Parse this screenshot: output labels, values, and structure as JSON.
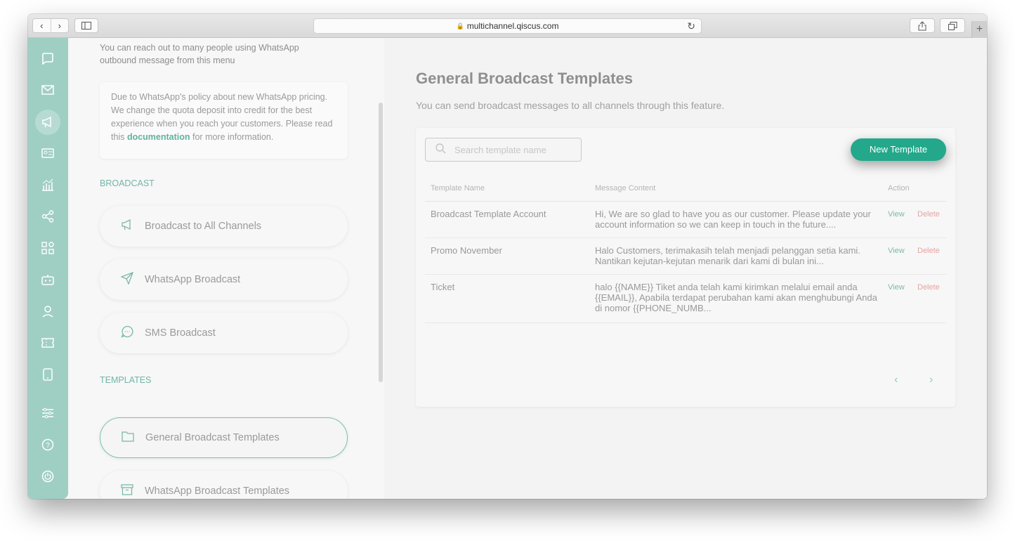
{
  "browser": {
    "url": "multichannel.qiscus.com",
    "back_icon": "‹",
    "forward_icon": "›"
  },
  "rail": {
    "icons": [
      "chat-icon",
      "mail-icon",
      "broadcast-icon",
      "contact-card-icon",
      "analytics-icon",
      "integration-icon",
      "apps-icon",
      "bot-icon",
      "agent-icon",
      "ticket-icon",
      "mobile-icon",
      "settings-sliders-icon",
      "help-icon",
      "power-icon"
    ]
  },
  "left": {
    "intro": "You can reach out to many people using WhatsApp outbound message from this menu",
    "notice_before": "Due to WhatsApp's policy about new WhatsApp pricing. We change the quota deposit into credit for the best experience when you reach your customers. Please read this ",
    "notice_link": "documentation",
    "notice_after": " for more information.",
    "broadcast_label": "BROADCAST",
    "broadcast_items": [
      "Broadcast to All Channels",
      "WhatsApp Broadcast",
      "SMS Broadcast"
    ],
    "templates_label": "TEMPLATES",
    "template_items": [
      "General Broadcast Templates",
      "WhatsApp Broadcast Templates"
    ]
  },
  "main": {
    "title": "General Broadcast Templates",
    "subtitle": "You can send broadcast messages to all channels through this feature.",
    "search_placeholder": "Search template name",
    "new_button": "New Template",
    "columns": [
      "Template Name",
      "Message Content",
      "Action"
    ],
    "rows": [
      {
        "name": "Broadcast Template Account",
        "content": "Hi, We are so glad to have you as our customer. Please update your account information so we can keep in touch in the future....",
        "view": "View",
        "delete": "Delete"
      },
      {
        "name": "Promo November",
        "content": "Halo Customers, terimakasih telah menjadi pelanggan setia kami. Nantikan kejutan-kejutan menarik dari kami di bulan ini...",
        "view": "View",
        "delete": "Delete"
      },
      {
        "name": "Ticket",
        "content": "halo {{NAME}} Tiket anda telah kami kirimkan melalui email anda {{EMAIL}}, Apabila terdapat perubahan kami akan menghubungi Anda di nomor {{PHONE_NUMB...",
        "view": "View",
        "delete": "Delete"
      }
    ],
    "pager_prev": "‹",
    "pager_next": "›"
  },
  "colors": {
    "accent": "#23a88b",
    "rail": "#9fcfc3",
    "delete": "#e6a3a3"
  }
}
